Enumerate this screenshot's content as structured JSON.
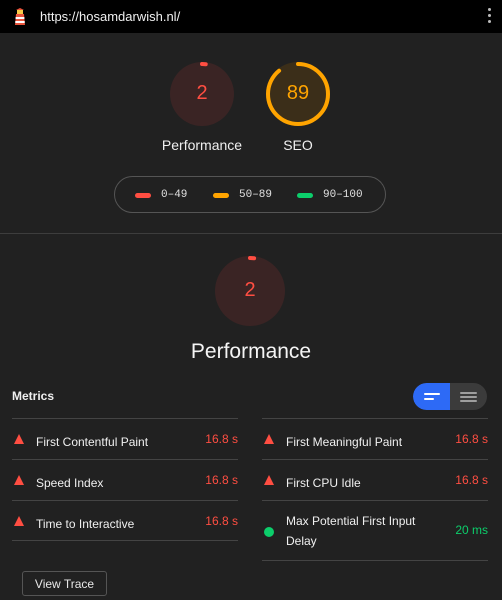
{
  "browser": {
    "url": "https://hosamdarwish.nl/",
    "logo_icon": "lighthouse-icon",
    "menu_icon": "kebab-menu-icon"
  },
  "summary": {
    "gauges": [
      {
        "label": "Performance",
        "score": "2",
        "score_value": 2,
        "color": "#ff4e42",
        "bg": "#3a2424"
      },
      {
        "label": "SEO",
        "score": "89",
        "score_value": 89,
        "color": "#ffa400",
        "bg": "#3b2e19"
      }
    ]
  },
  "legend": [
    {
      "range": "0–49",
      "color": "#ff4e42"
    },
    {
      "range": "50–89",
      "color": "#ffa400"
    },
    {
      "range": "90–100",
      "color": "#0cce6b"
    }
  ],
  "category": {
    "title": "Performance",
    "score": "2",
    "score_value": 2,
    "color": "#ff4e42"
  },
  "metrics": {
    "heading": "Metrics",
    "toggle": {
      "active": "expanded-view",
      "accent": "#2d6af6"
    },
    "left": [
      {
        "name": "First Contentful Paint",
        "value": "16.8 s",
        "status": "fail"
      },
      {
        "name": "Speed Index",
        "value": "16.8 s",
        "status": "fail"
      },
      {
        "name": "Time to Interactive",
        "value": "16.8 s",
        "status": "fail"
      }
    ],
    "right": [
      {
        "name": "First Meaningful Paint",
        "value": "16.8 s",
        "status": "fail"
      },
      {
        "name": "First CPU Idle",
        "value": "16.8 s",
        "status": "fail"
      },
      {
        "name": "Max Potential First Input Delay",
        "value": "20 ms",
        "status": "pass"
      }
    ],
    "colors": {
      "fail": "#ff4e42",
      "pass": "#0cce6b"
    }
  },
  "actions": {
    "view_trace": "View Trace"
  }
}
